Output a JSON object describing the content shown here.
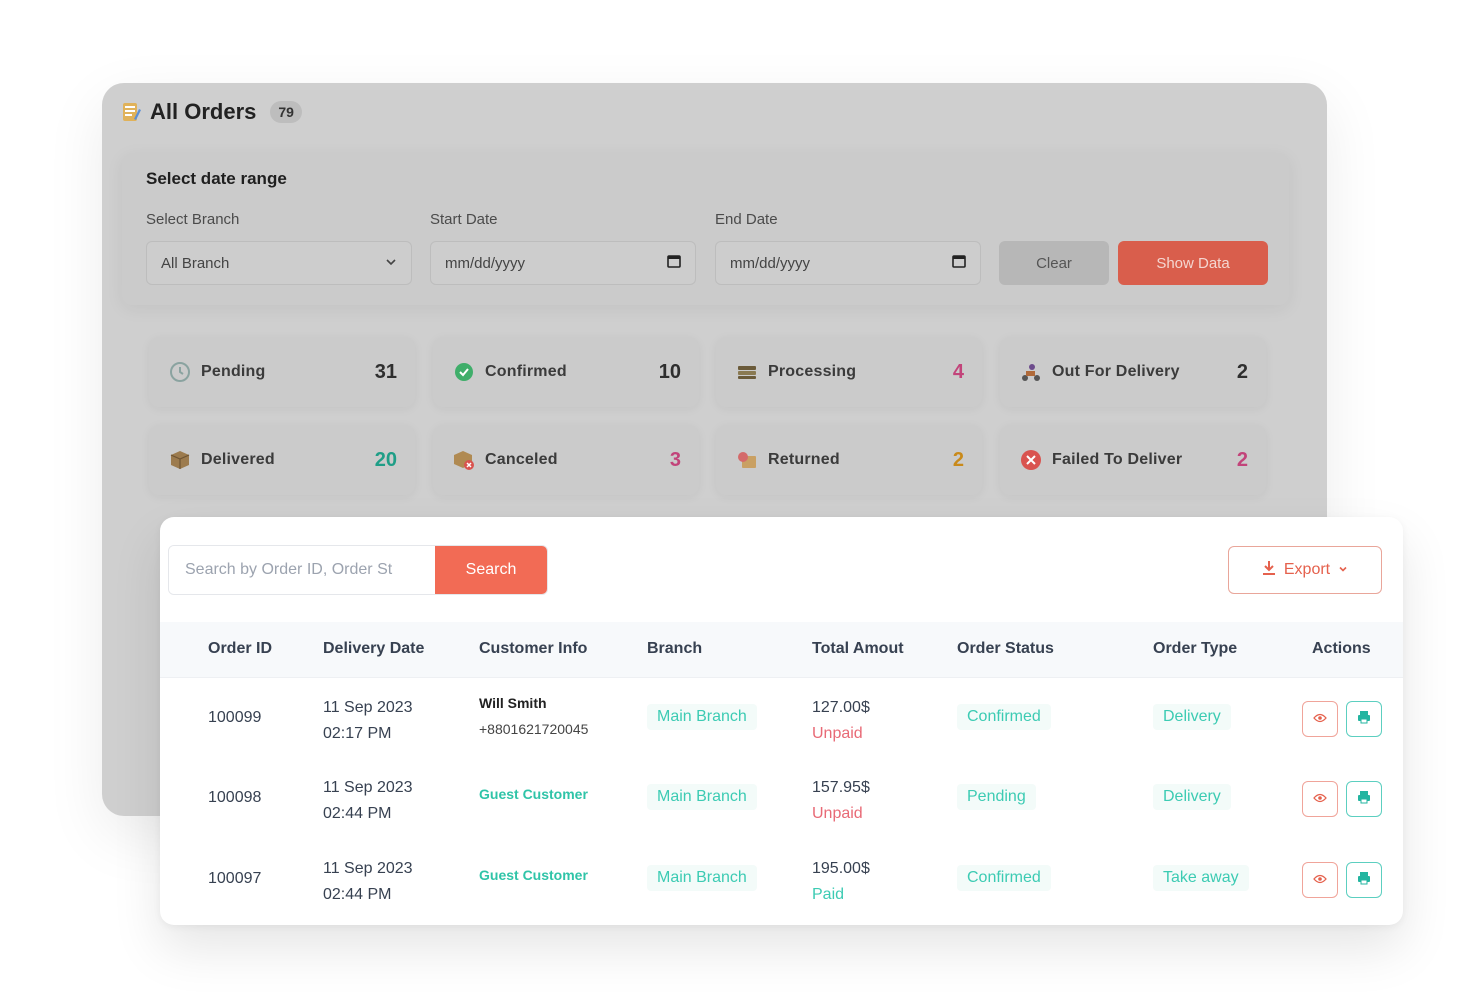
{
  "header": {
    "title": "All Orders",
    "count": "79"
  },
  "filters": {
    "heading": "Select date range",
    "branch_label": "Select Branch",
    "branch_value": "All Branch",
    "start_label": "Start Date",
    "start_placeholder": "mm/dd/yyyy",
    "end_label": "End Date",
    "end_placeholder": "mm/dd/yyyy",
    "clear_label": "Clear",
    "show_label": "Show Data"
  },
  "stats": [
    {
      "label": "Pending",
      "value": "31",
      "icon": "clock-icon",
      "color": "#2f2f2f"
    },
    {
      "label": "Confirmed",
      "value": "10",
      "icon": "check-circle-icon",
      "color": "#2f2f2f"
    },
    {
      "label": "Processing",
      "value": "4",
      "icon": "stack-icon",
      "color": "#c2447a"
    },
    {
      "label": "Out For Delivery",
      "value": "2",
      "icon": "delivery-bike-icon",
      "color": "#2f2f2f"
    },
    {
      "label": "Delivered",
      "value": "20",
      "icon": "box-icon",
      "color": "#1f9e87"
    },
    {
      "label": "Canceled",
      "value": "3",
      "icon": "box-cancel-icon",
      "color": "#c2447a"
    },
    {
      "label": "Returned",
      "value": "2",
      "icon": "return-icon",
      "color": "#c98a1a"
    },
    {
      "label": "Failed To Deliver",
      "value": "2",
      "icon": "x-circle-icon",
      "color": "#c2447a"
    }
  ],
  "search": {
    "placeholder": "Search by Order ID, Order St",
    "button": "Search"
  },
  "export": {
    "label": "Export"
  },
  "table": {
    "headers": [
      "Order ID",
      "Delivery Date",
      "Customer Info",
      "Branch",
      "Total Amout",
      "Order Status",
      "Order Type",
      "Actions"
    ],
    "rows": [
      {
        "id": "100099",
        "date": "11 Sep 2023",
        "time": "02:17 PM",
        "customer": "Will Smith",
        "phone": "+8801621720045",
        "guest": "",
        "branch": "Main Branch",
        "amount": "127.00$",
        "payment": "Unpaid",
        "status": "Confirmed",
        "type": "Delivery"
      },
      {
        "id": "100098",
        "date": "11 Sep 2023",
        "time": "02:44 PM",
        "customer": "",
        "phone": "",
        "guest": "Guest Customer",
        "branch": "Main Branch",
        "amount": "157.95$",
        "payment": "Unpaid",
        "status": "Pending",
        "type": "Delivery"
      },
      {
        "id": "100097",
        "date": "11 Sep 2023",
        "time": "02:44 PM",
        "customer": "",
        "phone": "",
        "guest": "Guest Customer",
        "branch": "Main Branch",
        "amount": "195.00$",
        "payment": "Paid",
        "status": "Confirmed",
        "type": "Take away"
      }
    ]
  },
  "colors": {
    "accent": "#f26b55",
    "teal": "#3ccbb3",
    "unpaid": "#e86a76"
  }
}
